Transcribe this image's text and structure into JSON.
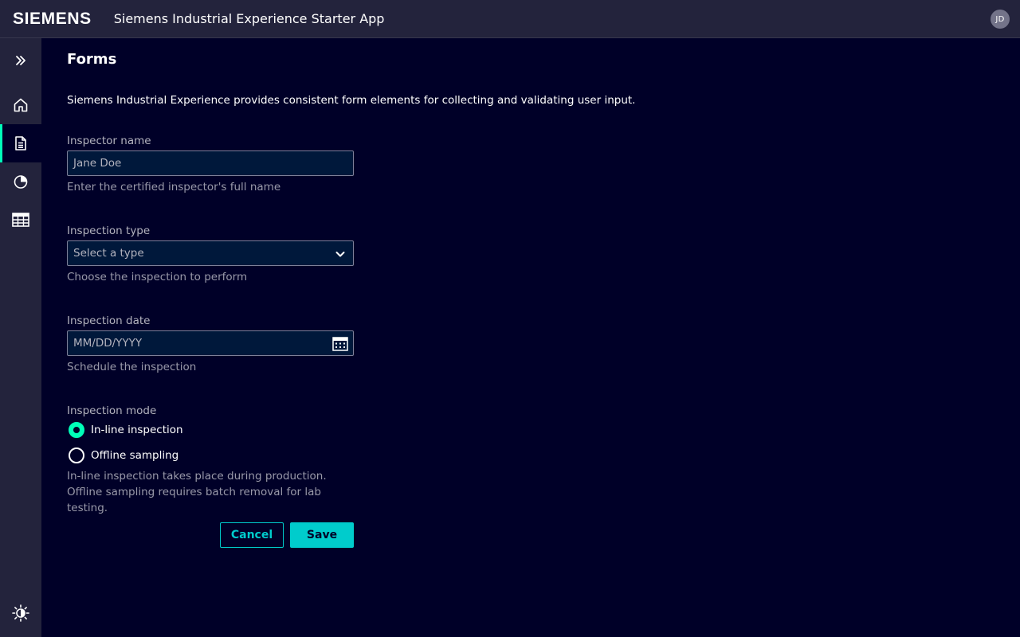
{
  "header": {
    "logo": "SIEMENS",
    "title": "Siemens Industrial Experience Starter App",
    "avatar_initials": "JD"
  },
  "sidebar": {
    "items": [
      {
        "icon": "double-chevron-right-icon"
      },
      {
        "icon": "home-icon"
      },
      {
        "icon": "document-icon",
        "active": true
      },
      {
        "icon": "pie-chart-icon"
      },
      {
        "icon": "table-icon"
      }
    ],
    "footer_icon": "theme-sun-icon"
  },
  "page": {
    "title": "Forms",
    "intro": "Siemens Industrial Experience provides consistent form elements for collecting and validating user input."
  },
  "form": {
    "inspector_name": {
      "label": "Inspector name",
      "value": "Jane Doe",
      "help": "Enter the certified inspector's full name"
    },
    "inspection_type": {
      "label": "Inspection type",
      "placeholder": "Select a type",
      "help": "Choose the inspection to perform"
    },
    "inspection_date": {
      "label": "Inspection date",
      "placeholder": "MM/DD/YYYY",
      "help": "Schedule the inspection"
    },
    "inspection_mode": {
      "label": "Inspection mode",
      "options": [
        {
          "label": "In-line inspection",
          "checked": true
        },
        {
          "label": "Offline sampling",
          "checked": false
        }
      ],
      "help": "In-line inspection takes place during production. Offline sampling requires batch removal for lab testing."
    },
    "cancel_label": "Cancel",
    "save_label": "Save"
  },
  "colors": {
    "background": "#000028",
    "chrome": "#23233c",
    "accent": "#00ffb9",
    "primary": "#00cccc"
  }
}
